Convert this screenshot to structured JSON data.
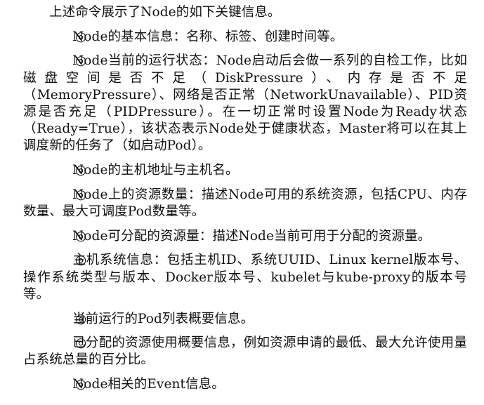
{
  "intro": "上述命令展示了Node的如下关键信息。",
  "bullet_symbol": "◎",
  "items": [
    "Node的基本信息：名称、标签、创建时间等。",
    "Node当前的运行状态：Node启动后会做一系列的自检工作，比如磁盘空间是否不足（DiskPressure）、内存是否不足（MemoryPressure）、网络是否正常（NetworkUnavailable）、PID资源是否充足（PIDPressure）。在一切正常时设置Node为Ready状态（Ready=True），该状态表示Node处于健康状态，Master将可以在其上调度新的任务了（如启动Pod）。",
    "Node的主机地址与主机名。",
    "Node上的资源数量：描述Node可用的系统资源，包括CPU、内存数量、最大可调度Pod数量等。",
    "Node可分配的资源量：描述Node当前可用于分配的资源量。",
    "主机系统信息：包括主机ID、系统UUID、Linux kernel版本号、操作系统类型与版本、Docker版本号、kubelet与kube-proxy的版本号等。",
    "当前运行的Pod列表概要信息。",
    "已分配的资源使用概要信息，例如资源申请的最低、最大允许使用量占系统总量的百分比。",
    "Node相关的Event信息。"
  ]
}
